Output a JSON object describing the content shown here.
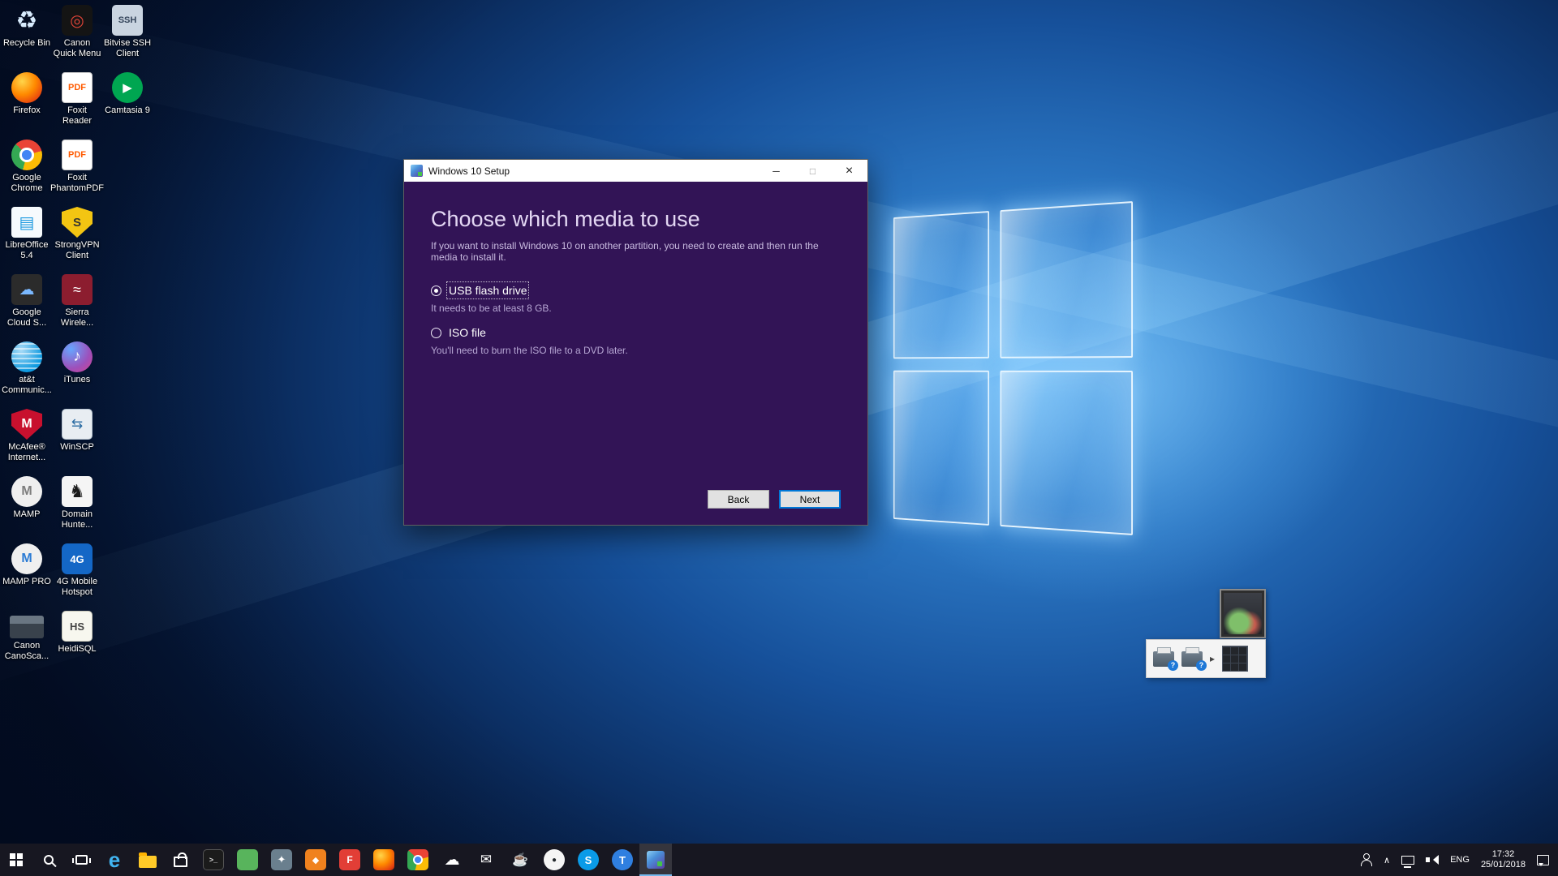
{
  "colors": {
    "dialog_background": "#321456",
    "taskbar_background": "#171721",
    "accent_blue": "#0078d7",
    "taskbar_active_indicator": "#76b9ed",
    "wallpaper_blue": "#2e7cc9"
  },
  "desktop": {
    "icons": [
      {
        "label": "Recycle Bin",
        "glyph": "♻"
      },
      {
        "label": "Canon Quick Menu",
        "glyph": "◎"
      },
      {
        "label": "Bitvise SSH Client",
        "glyph": "SSH"
      },
      {
        "label": "Firefox",
        "glyph": ""
      },
      {
        "label": "Foxit Reader",
        "glyph": "PDF"
      },
      {
        "label": "Camtasia 9",
        "glyph": "▶"
      },
      {
        "label": "Google Chrome",
        "glyph": ""
      },
      {
        "label": "Foxit PhantomPDF",
        "glyph": "PDF"
      },
      {
        "label": "LibreOffice 5.4",
        "glyph": "▤"
      },
      {
        "label": "StrongVPN Client",
        "glyph": "S"
      },
      {
        "label": "Google Cloud S...",
        "glyph": "☁"
      },
      {
        "label": "Sierra Wirele...",
        "glyph": "≈"
      },
      {
        "label": "at&t Communic...",
        "glyph": ""
      },
      {
        "label": "iTunes",
        "glyph": "♪"
      },
      {
        "label": "McAfee® Internet...",
        "glyph": "M"
      },
      {
        "label": "WinSCP",
        "glyph": "⇆"
      },
      {
        "label": "MAMP",
        "glyph": "M"
      },
      {
        "label": "Domain Hunte...",
        "glyph": "♞"
      },
      {
        "label": "MAMP PRO",
        "glyph": "M"
      },
      {
        "label": "4G Mobile Hotspot",
        "glyph": "4G"
      },
      {
        "label": "Canon CanoSca...",
        "glyph": ""
      },
      {
        "label": "HeidiSQL",
        "glyph": "HS"
      }
    ]
  },
  "dialog": {
    "title": "Windows 10 Setup",
    "controls": {
      "minimize": "─",
      "maximize": "□",
      "close": "×"
    },
    "heading": "Choose which media to use",
    "description": "If you want to install Windows 10 on another partition, you need to create and then run the media to install it.",
    "options": [
      {
        "label": "USB flash drive",
        "note": "It needs to be at least 8 GB.",
        "selected": true
      },
      {
        "label": "ISO file",
        "note": "You'll need to burn the ISO file to a DVD later.",
        "selected": false
      }
    ],
    "back_label": "Back",
    "next_label": "Next"
  },
  "taskbar": {
    "apps": [
      {
        "name": "edge",
        "glyph": "e"
      },
      {
        "name": "file-explorer",
        "glyph": ""
      },
      {
        "name": "store",
        "glyph": ""
      },
      {
        "name": "command-prompt",
        "glyph": ">_"
      },
      {
        "name": "green-app",
        "glyph": ""
      },
      {
        "name": "utility-app",
        "glyph": "✦"
      },
      {
        "name": "orange-app",
        "glyph": "◆"
      },
      {
        "name": "red-app",
        "glyph": "F"
      },
      {
        "name": "firefox",
        "glyph": ""
      },
      {
        "name": "chrome",
        "glyph": ""
      },
      {
        "name": "cloud-app",
        "glyph": "☁"
      },
      {
        "name": "mail",
        "glyph": "✉"
      },
      {
        "name": "java-app",
        "glyph": "☕"
      },
      {
        "name": "round-app",
        "glyph": "●"
      },
      {
        "name": "skype",
        "glyph": "S"
      },
      {
        "name": "blue-app",
        "glyph": "T"
      },
      {
        "name": "windows-10-setup",
        "glyph": "",
        "active": true
      }
    ],
    "tray": {
      "chevron": "∧",
      "language": "ENG",
      "time": "17:32",
      "date": "25/01/2018"
    }
  },
  "tray_flyout": {
    "badge": "?",
    "arrow": "▸"
  }
}
